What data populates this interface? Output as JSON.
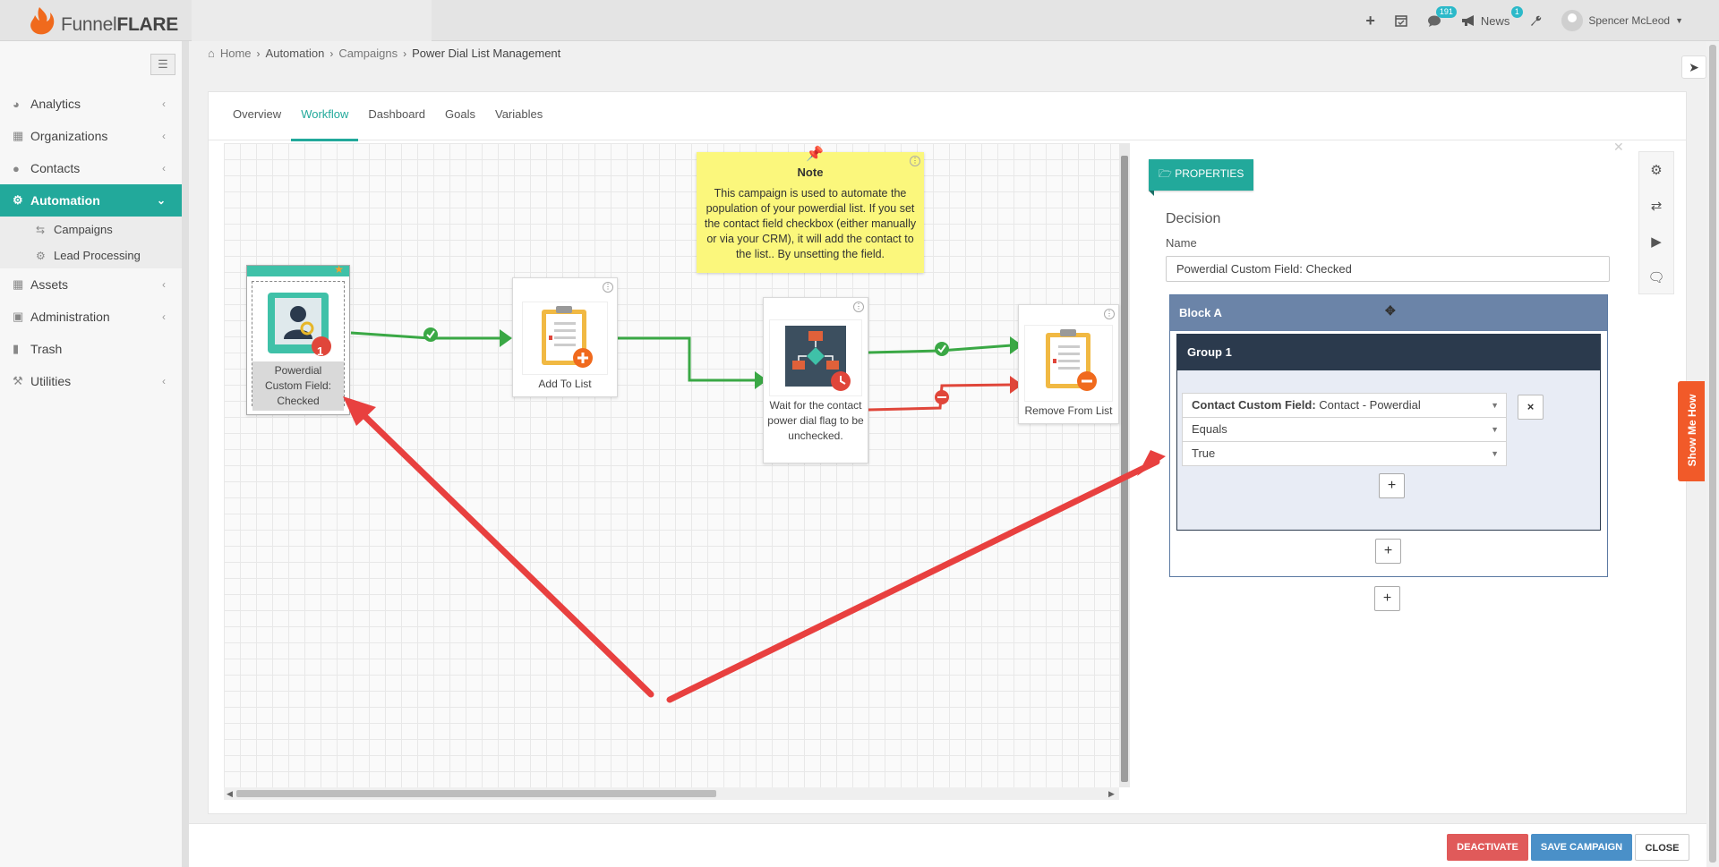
{
  "app": {
    "brand_light": "Funnel",
    "brand_bold": "FLARE"
  },
  "header": {
    "add_icon": "plus-icon",
    "tasks_icon": "calendar-check-icon",
    "notifications_count": "191",
    "news_label": "News",
    "news_count": "1",
    "user_name": "Spencer McLeod"
  },
  "sidebar": {
    "items": [
      {
        "label": "Analytics",
        "icon": "dashboard-icon"
      },
      {
        "label": "Organizations",
        "icon": "sitemap-icon"
      },
      {
        "label": "Contacts",
        "icon": "users-icon"
      },
      {
        "label": "Automation",
        "icon": "cogs-icon",
        "active": true
      },
      {
        "label": "Assets",
        "icon": "grid-icon"
      },
      {
        "label": "Administration",
        "icon": "lock-icon"
      },
      {
        "label": "Trash",
        "icon": "trash-icon"
      },
      {
        "label": "Utilities",
        "icon": "wrench-icon"
      }
    ],
    "subitems": [
      {
        "label": "Campaigns",
        "icon": "retweet-icon"
      },
      {
        "label": "Lead Processing",
        "icon": "cogs-icon"
      }
    ]
  },
  "breadcrumb": {
    "home": "Home",
    "automation": "Automation",
    "campaigns": "Campaigns",
    "current": "Power Dial List Management"
  },
  "tabs": [
    "Overview",
    "Workflow",
    "Dashboard",
    "Goals",
    "Variables"
  ],
  "workflow": {
    "nodes": [
      {
        "label": "Powerdial Custom Field: Checked",
        "badge": "1"
      },
      {
        "label": "Add To List"
      },
      {
        "label": "Wait for the contact power dial flag to be unchecked."
      },
      {
        "label": "Remove From List"
      }
    ],
    "note": {
      "title": "Note",
      "text": "This campaign is used to automate the population of your powerdial list. If you set the contact field checkbox (either manually or via your CRM), it will add the contact to the list.. By unsetting the field."
    }
  },
  "properties": {
    "tag": "PROPERTIES",
    "type": "Decision",
    "name_label": "Name",
    "name_value": "Powerdial Custom Field: Checked",
    "block": "Block A",
    "group": "Group 1",
    "condition_field_label": "Contact Custom Field:",
    "condition_field_value": "Contact - Powerdial",
    "operator": "Equals",
    "value": "True"
  },
  "show_me_how": "Show Me How",
  "footer": {
    "deactivate": "DEACTIVATE",
    "save": "SAVE CAMPAIGN",
    "close": "CLOSE"
  },
  "colors": {
    "accent": "#22a99b",
    "success": "#3aa845",
    "danger": "#e0463a",
    "arrow": "#e8403f"
  }
}
